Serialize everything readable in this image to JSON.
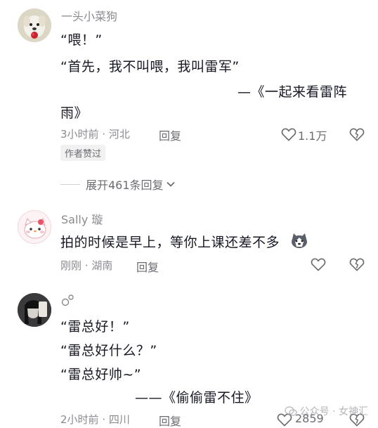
{
  "comments": [
    {
      "username": "一头小菜狗",
      "lines": [
        "“喂！”",
        "“首先，我不叫喂，我叫雷军”",
        "—《一起来看雷阵",
        "雨》"
      ],
      "time": "3小时前",
      "location": "河北",
      "reply": "回复",
      "likes": "1.1万",
      "badge": "作者赞过"
    },
    {
      "username": "Sally 璇",
      "lines": [
        "拍的时候是早上，等你上课还差不多"
      ],
      "time": "刚刚",
      "location": "湖南",
      "reply": "回复"
    },
    {
      "username": "",
      "lines": [
        "“雷总好！”",
        "“雷总好什么？”",
        "“雷总好帅~”",
        "——《偷偷雷不住》"
      ],
      "time": "2小时前",
      "location": "四川",
      "reply": "回复",
      "likes": "2859"
    }
  ],
  "expand": {
    "label": "展开461条回复"
  },
  "watermark": {
    "text": "公众号 · 女神汇"
  },
  "colors": {
    "text": "#161823",
    "secondary": "#8a8b91",
    "heart_outline": "#6b6c72"
  }
}
